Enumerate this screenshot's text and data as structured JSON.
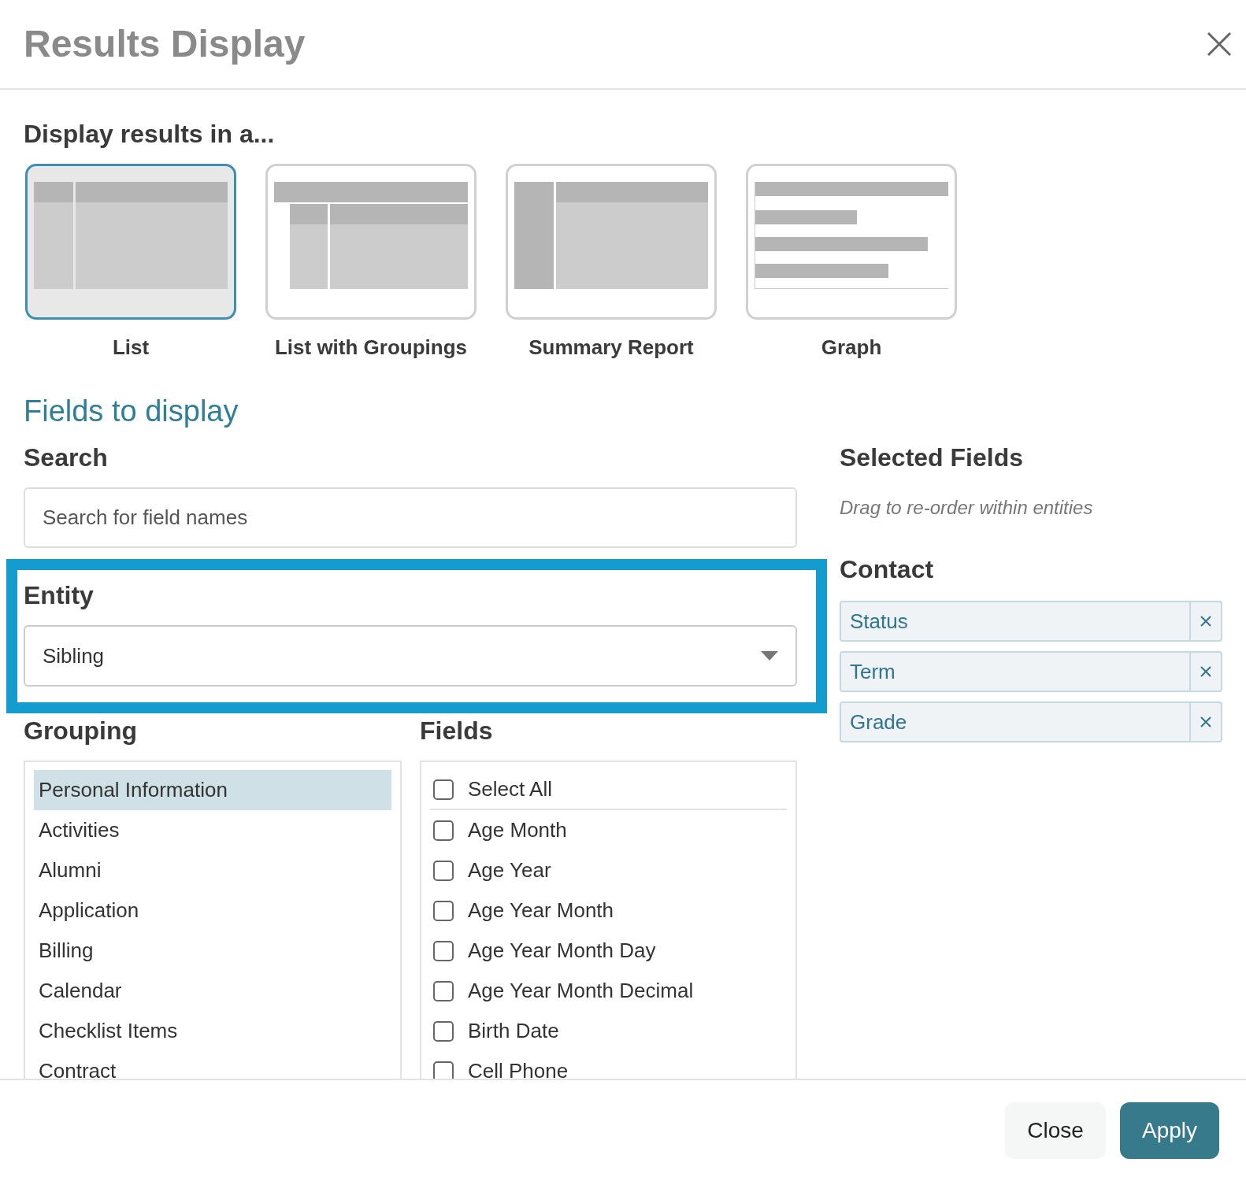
{
  "dialog": {
    "title": "Results Display"
  },
  "display": {
    "heading": "Display results in a...",
    "options": [
      {
        "kind": "list",
        "label": "List",
        "selected": true
      },
      {
        "kind": "groupings",
        "label": "List with Groupings",
        "selected": false
      },
      {
        "kind": "summary",
        "label": "Summary Report",
        "selected": false
      },
      {
        "kind": "graph",
        "label": "Graph",
        "selected": false
      }
    ]
  },
  "fields_section": {
    "heading": "Fields to display"
  },
  "search": {
    "label": "Search",
    "placeholder": "Search for field names"
  },
  "entity": {
    "label": "Entity",
    "value": "Sibling"
  },
  "grouping": {
    "label": "Grouping",
    "items": [
      {
        "label": "Personal Information",
        "selected": true
      },
      {
        "label": "Activities",
        "selected": false
      },
      {
        "label": "Alumni",
        "selected": false
      },
      {
        "label": "Application",
        "selected": false
      },
      {
        "label": "Billing",
        "selected": false
      },
      {
        "label": "Calendar",
        "selected": false
      },
      {
        "label": "Checklist Items",
        "selected": false
      },
      {
        "label": "Contract",
        "selected": false
      }
    ]
  },
  "fields": {
    "label": "Fields",
    "select_all": {
      "label": "Select All",
      "checked": false
    },
    "items": [
      {
        "label": "Age Month",
        "checked": false
      },
      {
        "label": "Age Year",
        "checked": false
      },
      {
        "label": "Age Year Month",
        "checked": false
      },
      {
        "label": "Age Year Month Day",
        "checked": false
      },
      {
        "label": "Age Year Month Decimal",
        "checked": false
      },
      {
        "label": "Birth Date",
        "checked": false
      },
      {
        "label": "Cell Phone",
        "checked": false
      }
    ]
  },
  "selected_fields": {
    "heading": "Selected Fields",
    "hint": "Drag to re-order within entities",
    "groups": [
      {
        "entity": "Contact",
        "fields": [
          "Status",
          "Term",
          "Grade"
        ]
      }
    ]
  },
  "buttons": {
    "close": "Close",
    "apply": "Apply"
  }
}
